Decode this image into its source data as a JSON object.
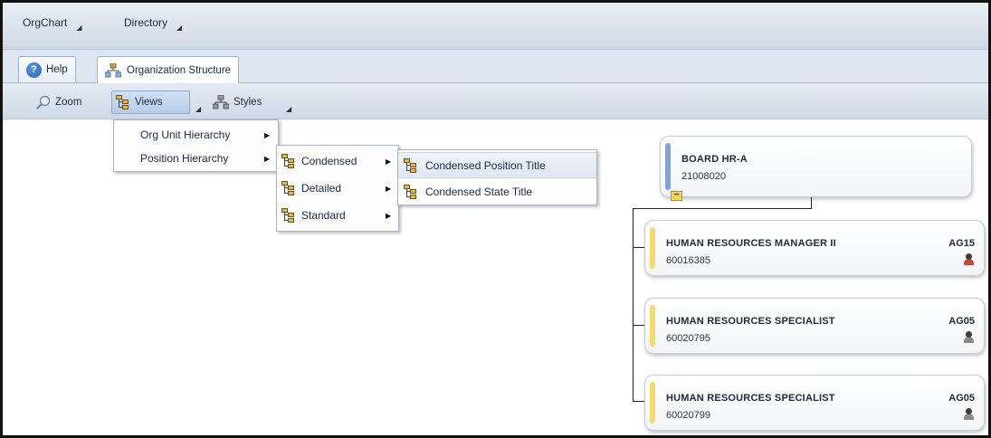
{
  "menubar": {
    "items": [
      {
        "label": "OrgChart"
      },
      {
        "label": "Directory"
      }
    ]
  },
  "tabs": [
    {
      "label": "Help",
      "icon": "help-icon"
    },
    {
      "label": "Organization Structure",
      "icon": "org-structure-icon"
    }
  ],
  "toolbar": {
    "zoom_label": "Zoom",
    "views_label": "Views",
    "styles_label": "Styles"
  },
  "views_menu": {
    "items": [
      {
        "label": "Org Unit Hierarchy"
      },
      {
        "label": "Position Hierarchy"
      }
    ]
  },
  "position_menu": {
    "items": [
      {
        "label": "Condensed"
      },
      {
        "label": "Detailed"
      },
      {
        "label": "Standard"
      }
    ]
  },
  "condensed_menu": {
    "items": [
      {
        "label": "Condensed Position Title",
        "highlighted": true
      },
      {
        "label": "Condensed State Title"
      }
    ]
  },
  "orgchart": {
    "root": {
      "title": "BOARD HR-A",
      "number": "21008020",
      "accent": "#7fa2d9"
    },
    "children": [
      {
        "title": "HUMAN RESOURCES MANAGER II",
        "number": "60016385",
        "grade": "AG15",
        "accent": "#f2dc6e",
        "person_color": "#c9443a"
      },
      {
        "title": "HUMAN RESOURCES SPECIALIST",
        "number": "60020795",
        "grade": "AG05",
        "accent": "#f2dc6e",
        "person_color": "#8a8a8a"
      },
      {
        "title": "HUMAN RESOURCES SPECIALIST",
        "number": "60020799",
        "grade": "AG05",
        "accent": "#f2dc6e",
        "person_color": "#8a8a8a"
      }
    ]
  }
}
